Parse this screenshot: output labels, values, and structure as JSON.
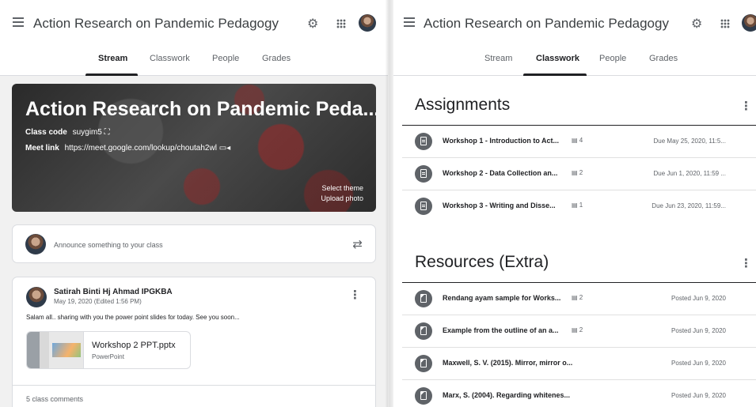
{
  "left": {
    "course_title": "Action Research on Pandemic Pedagogy",
    "tabs": [
      {
        "label": "Stream",
        "active": true
      },
      {
        "label": "Classwork",
        "active": false
      },
      {
        "label": "People",
        "active": false
      },
      {
        "label": "Grades",
        "active": false
      }
    ],
    "banner": {
      "title": "Action Research on Pandemic Peda...",
      "class_code_label": "Class code",
      "class_code": "suygim5",
      "meet_link_label": "Meet link",
      "meet_link": "https://meet.google.com/lookup/choutah2wl",
      "select_theme": "Select theme",
      "upload_photo": "Upload photo"
    },
    "announce_placeholder": "Announce something to your class",
    "post": {
      "author": "Satirah Binti Hj Ahmad IPGKBA",
      "date": "May 19, 2020 (Edited 1:56 PM)",
      "body": "Salam all.. sharing with you the power point slides for today. See you soon...",
      "attachment_name": "Workshop 2 PPT.pptx",
      "attachment_type": "PowerPoint",
      "comments": "5 class comments"
    }
  },
  "right": {
    "course_title": "Action Research on Pandemic Pedagogy",
    "tabs": [
      {
        "label": "Stream",
        "active": false
      },
      {
        "label": "Classwork",
        "active": true
      },
      {
        "label": "People",
        "active": false
      },
      {
        "label": "Grades",
        "active": false
      }
    ],
    "assignments": {
      "title": "Assignments",
      "items": [
        {
          "title": "Workshop 1 - Introduction to Act...",
          "count": "4",
          "meta": "Due May 25, 2020, 11:5..."
        },
        {
          "title": "Workshop 2 - Data Collection an...",
          "count": "2",
          "meta": "Due Jun 1, 2020, 11:59 ..."
        },
        {
          "title": "Workshop 3 - Writing and Disse...",
          "count": "1",
          "meta": "Due Jun 23, 2020, 11:59..."
        }
      ]
    },
    "resources": {
      "title": "Resources (Extra)",
      "items": [
        {
          "title": "Rendang ayam sample for Works...",
          "count": "2",
          "meta": "Posted Jun 9, 2020"
        },
        {
          "title": "Example from the outline of an a...",
          "count": "2",
          "meta": "Posted Jun 9, 2020"
        },
        {
          "title": "Maxwell, S. V. (2015). Mirror, mirror o...",
          "count": "",
          "meta": "Posted Jun 9, 2020"
        },
        {
          "title": "Marx, S. (2004). Regarding whitenes...",
          "count": "",
          "meta": "Posted Jun 9, 2020"
        }
      ]
    }
  }
}
